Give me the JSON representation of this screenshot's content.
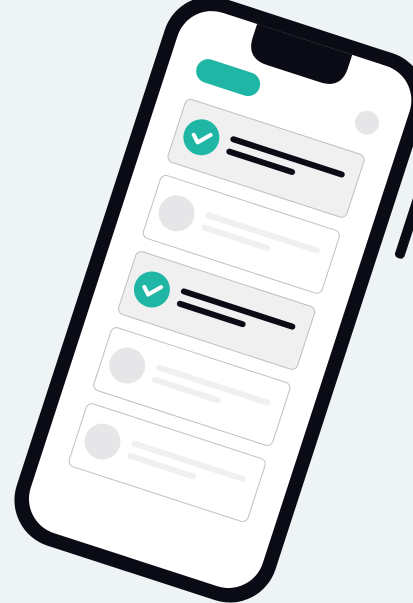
{
  "colors": {
    "background": "#eef3f6",
    "phone_frame": "#0b0b16",
    "screen": "#ffffff",
    "accent": "#1fb6a6",
    "card_checked_bg": "#f0f0f1",
    "card_unchecked_bg": "#ffffff",
    "card_border": "#bfbfc3",
    "placeholder": "#e6e6e8",
    "placeholder_line": "#f0f0f2",
    "dark_line": "#0b0b16"
  },
  "icons": {
    "check": "check-icon",
    "avatar": "avatar-placeholder-icon"
  },
  "list": {
    "items": [
      {
        "checked": true
      },
      {
        "checked": false
      },
      {
        "checked": true
      },
      {
        "checked": false
      },
      {
        "checked": false
      }
    ]
  }
}
